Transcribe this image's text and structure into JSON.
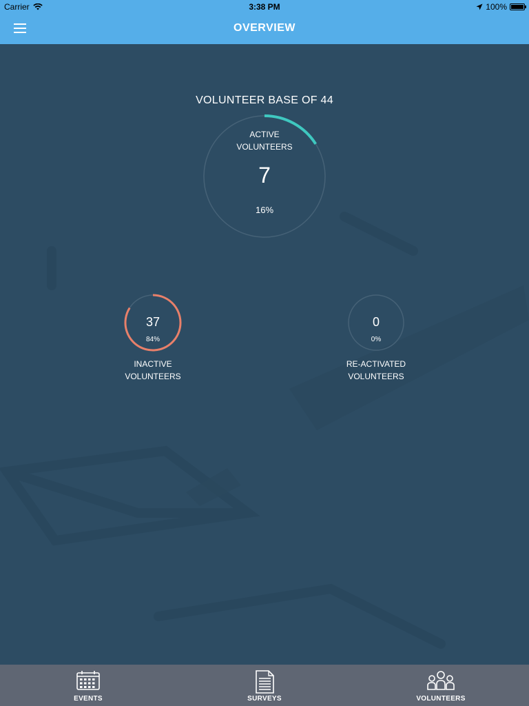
{
  "status_bar": {
    "carrier": "Carrier",
    "time": "3:38 PM",
    "battery": "100%"
  },
  "nav": {
    "title": "OVERVIEW",
    "menu_icon": "hamburger-menu-icon"
  },
  "volunteer_base": {
    "title": "VOLUNTEER BASE OF 44",
    "active": {
      "label_line1": "ACTIVE",
      "label_line2": "VOLUNTEERS",
      "count": "7",
      "percent_text": "16%",
      "fraction": 0.16,
      "color": "#3fc8c0"
    },
    "inactive": {
      "count": "37",
      "percent_text": "84%",
      "fraction": 0.84,
      "label_line1": "INACTIVE",
      "label_line2": "VOLUNTEERS",
      "color": "#e8806a"
    },
    "reactivated": {
      "count": "0",
      "percent_text": "0%",
      "fraction": 0,
      "label_line1": "RE-ACTIVATED",
      "label_line2": "VOLUNTEERS",
      "color": "#3fc8c0"
    }
  },
  "tabs": [
    {
      "label": "EVENTS",
      "icon": "calendar-icon"
    },
    {
      "label": "SURVEYS",
      "icon": "document-icon"
    },
    {
      "label": "VOLUNTEERS",
      "icon": "group-icon"
    }
  ],
  "colors": {
    "nav_blue": "#55aee9",
    "background": "#2d4c63",
    "tab_bar": "#5f6673",
    "ring_track": "#466277"
  }
}
